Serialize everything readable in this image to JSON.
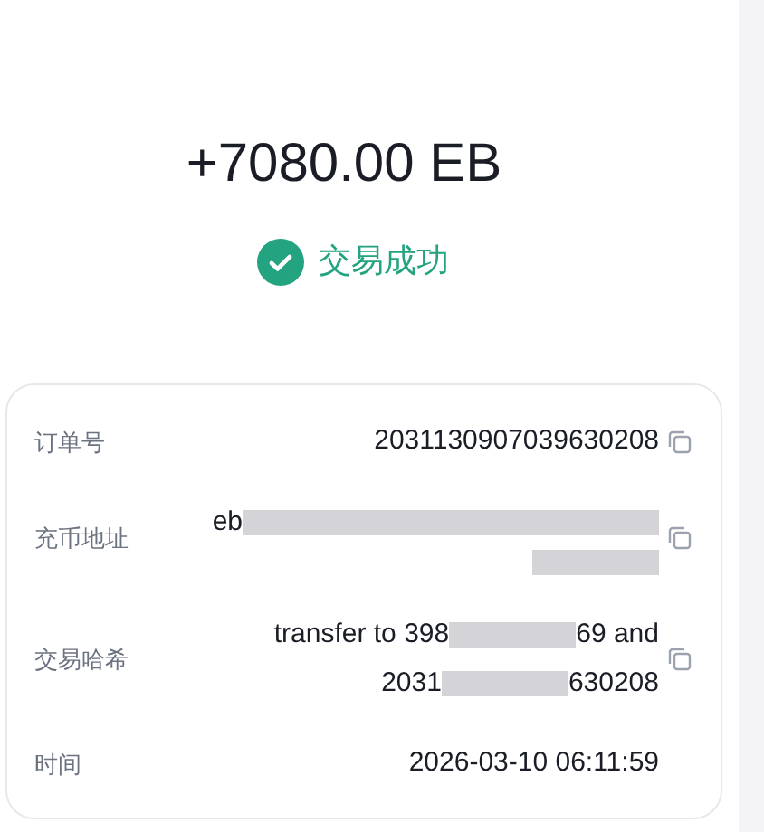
{
  "amount": "+7080.00 EB",
  "status": {
    "kind": "success",
    "label": "交易成功"
  },
  "details": [
    {
      "label": "订单号",
      "copyable": true,
      "lines": [
        [
          {
            "kind": "text",
            "text": "2031130907039630208"
          }
        ]
      ]
    },
    {
      "label": "充币地址",
      "copyable": true,
      "lines": [
        [
          {
            "kind": "text",
            "text": "eb"
          },
          {
            "kind": "redacted"
          }
        ],
        [
          {
            "kind": "redacted"
          }
        ]
      ]
    },
    {
      "label": "交易哈希",
      "copyable": true,
      "lines": [
        [
          {
            "kind": "text",
            "text": "transfer to 398"
          },
          {
            "kind": "redacted"
          },
          {
            "kind": "text",
            "text": "69 and"
          }
        ],
        [
          {
            "kind": "text",
            "text": "2031"
          },
          {
            "kind": "redacted"
          },
          {
            "kind": "text",
            "text": "630208"
          }
        ]
      ]
    },
    {
      "label": "时间",
      "copyable": false,
      "lines": [
        [
          {
            "kind": "text",
            "text": "2026-03-10 06:11:59"
          }
        ]
      ]
    }
  ]
}
